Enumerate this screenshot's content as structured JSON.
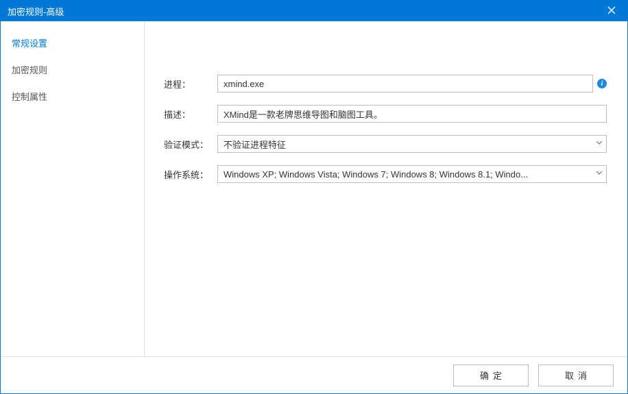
{
  "window": {
    "title": "加密规则-高级"
  },
  "sidebar": {
    "items": [
      {
        "label": "常规设置",
        "active": true
      },
      {
        "label": "加密规则",
        "active": false
      },
      {
        "label": "控制属性",
        "active": false
      }
    ]
  },
  "form": {
    "process": {
      "label": "进程：",
      "value": "xmind.exe"
    },
    "description": {
      "label": "描述：",
      "value": "XMind是一款老牌思维导图和脑图工具。"
    },
    "verify_mode": {
      "label": "验证模式：",
      "value": "不验证进程特征"
    },
    "os": {
      "label": "操作系统：",
      "value": "Windows XP; Windows Vista; Windows 7; Windows 8; Windows 8.1; Windo..."
    }
  },
  "footer": {
    "ok_label": "确定",
    "cancel_label": "取消"
  },
  "info_icon_glyph": "i"
}
